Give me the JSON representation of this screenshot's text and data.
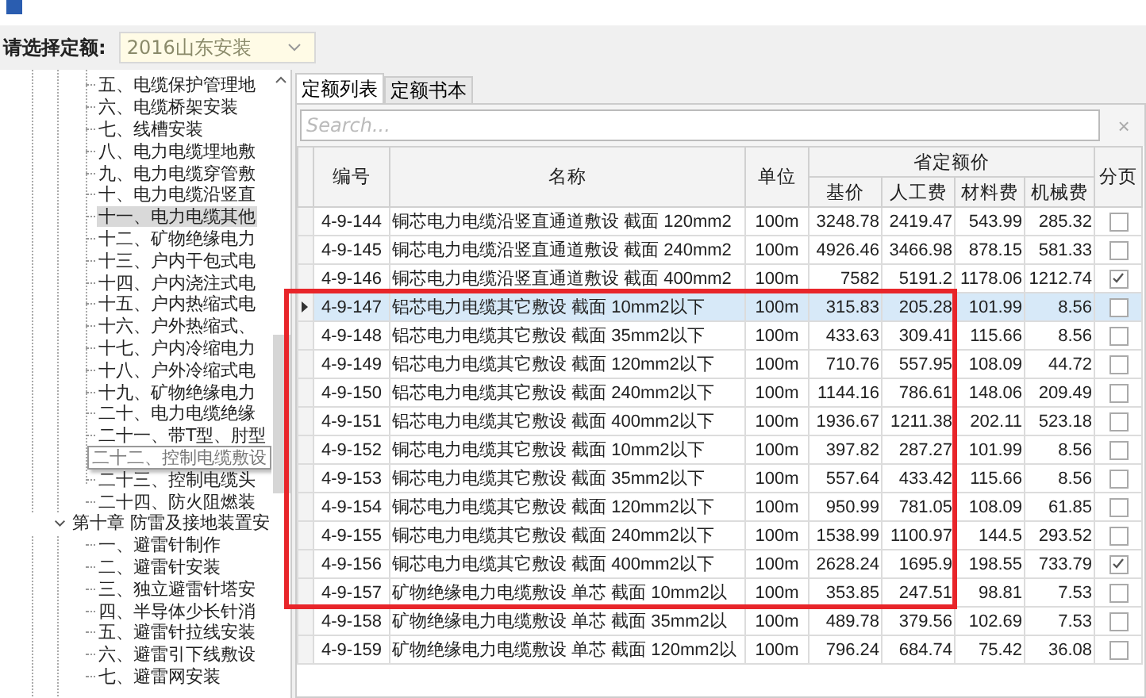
{
  "quota_selector": {
    "label": "请选择定额:",
    "value": "2016山东安装"
  },
  "tree": {
    "items": [
      {
        "label": "五、电缆保护管理地",
        "selected": false,
        "hovered": false
      },
      {
        "label": "六、电缆桥架安装",
        "selected": false,
        "hovered": false
      },
      {
        "label": "七、线槽安装",
        "selected": false,
        "hovered": false
      },
      {
        "label": "八、电力电缆埋地敷",
        "selected": false,
        "hovered": false
      },
      {
        "label": "九、电力电缆穿管敷",
        "selected": false,
        "hovered": false
      },
      {
        "label": "十、电力电缆沿竖直",
        "selected": false,
        "hovered": false
      },
      {
        "label": "十一、电力电缆其他",
        "selected": true,
        "hovered": false
      },
      {
        "label": "十二、矿物绝缘电力",
        "selected": false,
        "hovered": false
      },
      {
        "label": "十三、户内干包式电",
        "selected": false,
        "hovered": false
      },
      {
        "label": "十四、户内浇注式电",
        "selected": false,
        "hovered": false
      },
      {
        "label": "十五、户内热缩式电",
        "selected": false,
        "hovered": false
      },
      {
        "label": "十六、户外热缩式、",
        "selected": false,
        "hovered": false
      },
      {
        "label": "十七、户内冷缩电力",
        "selected": false,
        "hovered": false
      },
      {
        "label": "十八、户外冷缩式电",
        "selected": false,
        "hovered": false
      },
      {
        "label": "十九、矿物绝缘电力",
        "selected": false,
        "hovered": false
      },
      {
        "label": "二十、电力电缆绝缘",
        "selected": false,
        "hovered": false
      },
      {
        "label": "二十一、带T型、肘型",
        "selected": false,
        "hovered": false
      },
      {
        "label": "二十二、控制电缆敷设",
        "selected": false,
        "hovered": true
      },
      {
        "label": "二十三、控制电缆头",
        "selected": false,
        "hovered": false
      },
      {
        "label": "二十四、防火阻燃装",
        "selected": false,
        "hovered": false
      },
      {
        "label": "第十章 防雷及接地装置安",
        "expanded": true,
        "selected": false,
        "hovered": false,
        "children": [
          {
            "label": "一、避雷针制作",
            "selected": false,
            "hovered": false
          },
          {
            "label": "二、避雷针安装",
            "selected": false,
            "hovered": false
          },
          {
            "label": "三、独立避雷针塔安",
            "selected": false,
            "hovered": false
          },
          {
            "label": "四、半导体少长针消",
            "selected": false,
            "hovered": false
          },
          {
            "label": "五、避雷针拉线安装",
            "selected": false,
            "hovered": false
          },
          {
            "label": "六、避雷引下线敷设",
            "selected": false,
            "hovered": false
          },
          {
            "label": "七、避雷网安装",
            "selected": false,
            "hovered": false
          }
        ]
      }
    ]
  },
  "tabs": [
    {
      "label": "定额列表",
      "selected": true
    },
    {
      "label": "定额书本",
      "selected": false
    }
  ],
  "search": {
    "placeholder": "Search...",
    "clear": "×"
  },
  "table": {
    "columns": {
      "code": "编号",
      "name": "名称",
      "unit": "单位",
      "group": "省定额价",
      "base": "基价",
      "labor": "人工费",
      "material": "材料费",
      "machine": "机械费",
      "paging": "分页"
    },
    "rows": [
      {
        "code": "4-9-144",
        "name": "铜芯电力电缆沿竖直通道敷设 截面 120mm2",
        "unit": "100m",
        "base": "3248.78",
        "labor": "2419.47",
        "material": "543.99",
        "machine": "285.32",
        "checked": false,
        "selected": false
      },
      {
        "code": "4-9-145",
        "name": "铜芯电力电缆沿竖直通道敷设 截面 240mm2",
        "unit": "100m",
        "base": "4926.46",
        "labor": "3466.98",
        "material": "878.15",
        "machine": "581.33",
        "checked": false,
        "selected": false
      },
      {
        "code": "4-9-146",
        "name": "铜芯电力电缆沿竖直通道敷设 截面 400mm2",
        "unit": "100m",
        "base": "7582",
        "labor": "5191.2",
        "material": "1178.06",
        "machine": "1212.74",
        "checked": true,
        "selected": false
      },
      {
        "code": "4-9-147",
        "name": "铝芯电力电缆其它敷设 截面 10mm2以下",
        "unit": "100m",
        "base": "315.83",
        "labor": "205.28",
        "material": "101.99",
        "machine": "8.56",
        "checked": false,
        "selected": true,
        "frame_start": true
      },
      {
        "code": "4-9-148",
        "name": "铝芯电力电缆其它敷设 截面 35mm2以下",
        "unit": "100m",
        "base": "433.63",
        "labor": "309.41",
        "material": "115.66",
        "machine": "8.56",
        "checked": false,
        "selected": false
      },
      {
        "code": "4-9-149",
        "name": "铝芯电力电缆其它敷设 截面 120mm2以下",
        "unit": "100m",
        "base": "710.76",
        "labor": "557.95",
        "material": "108.09",
        "machine": "44.72",
        "checked": false,
        "selected": false
      },
      {
        "code": "4-9-150",
        "name": "铝芯电力电缆其它敷设 截面 240mm2以下",
        "unit": "100m",
        "base": "1144.16",
        "labor": "786.61",
        "material": "148.06",
        "machine": "209.49",
        "checked": false,
        "selected": false
      },
      {
        "code": "4-9-151",
        "name": "铝芯电力电缆其它敷设 截面 400mm2以下",
        "unit": "100m",
        "base": "1936.67",
        "labor": "1211.38",
        "material": "202.11",
        "machine": "523.18",
        "checked": false,
        "selected": false
      },
      {
        "code": "4-9-152",
        "name": "铜芯电力电缆其它敷设 截面 10mm2以下",
        "unit": "100m",
        "base": "397.82",
        "labor": "287.27",
        "material": "101.99",
        "machine": "8.56",
        "checked": false,
        "selected": false
      },
      {
        "code": "4-9-153",
        "name": "铜芯电力电缆其它敷设 截面 35mm2以下",
        "unit": "100m",
        "base": "557.64",
        "labor": "433.42",
        "material": "115.66",
        "machine": "8.56",
        "checked": false,
        "selected": false
      },
      {
        "code": "4-9-154",
        "name": "铜芯电力电缆其它敷设 截面 120mm2以下",
        "unit": "100m",
        "base": "950.99",
        "labor": "781.05",
        "material": "108.09",
        "machine": "61.85",
        "checked": false,
        "selected": false
      },
      {
        "code": "4-9-155",
        "name": "铜芯电力电缆其它敷设 截面 240mm2以下",
        "unit": "100m",
        "base": "1538.99",
        "labor": "1100.97",
        "material": "144.5",
        "machine": "293.52",
        "checked": false,
        "selected": false
      },
      {
        "code": "4-9-156",
        "name": "铜芯电力电缆其它敷设 截面 400mm2以下",
        "unit": "100m",
        "base": "2628.24",
        "labor": "1695.9",
        "material": "198.55",
        "machine": "733.79",
        "checked": true,
        "selected": false
      },
      {
        "code": "4-9-157",
        "name": "矿物绝缘电力电缆敷设 单芯 截面 10mm2以",
        "unit": "100m",
        "base": "353.85",
        "labor": "247.51",
        "material": "98.81",
        "machine": "7.53",
        "checked": false,
        "selected": false,
        "frame_end": true
      },
      {
        "code": "4-9-158",
        "name": "矿物绝缘电力电缆敷设 单芯 截面 35mm2以",
        "unit": "100m",
        "base": "489.78",
        "labor": "379.56",
        "material": "102.69",
        "machine": "7.53",
        "checked": false,
        "selected": false
      },
      {
        "code": "4-9-159",
        "name": "矿物绝缘电力电缆敷设 单芯 截面 120mm2以",
        "unit": "100m",
        "base": "796.24",
        "labor": "684.74",
        "material": "75.42",
        "machine": "36.08",
        "checked": false,
        "selected": false
      }
    ]
  }
}
